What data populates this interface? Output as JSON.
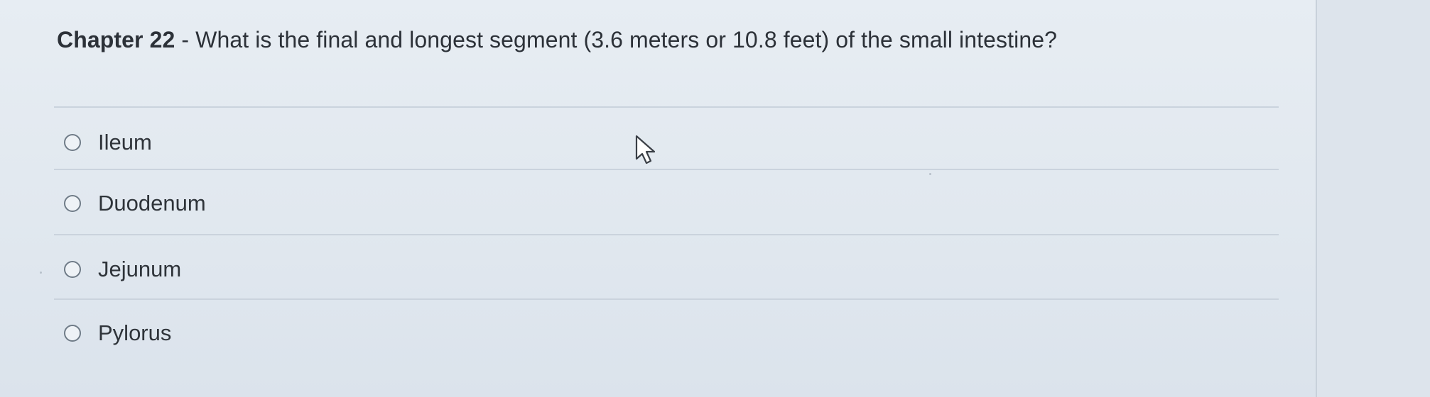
{
  "question": {
    "prefix": "Chapter 22",
    "separator": " - ",
    "text": "What is the final and longest segment (3.6 meters or 10.8 feet) of the small intestine?"
  },
  "choices": [
    {
      "label": "Ileum"
    },
    {
      "label": "Duodenum"
    },
    {
      "label": "Jejunum"
    },
    {
      "label": "Pylorus"
    }
  ],
  "cursor": {
    "icon": "mouse-pointer-icon"
  },
  "colors": {
    "background": "#e1e8ef",
    "text": "#2c3138",
    "divider": "#cad3dd",
    "radio_border": "#6f7b87"
  }
}
